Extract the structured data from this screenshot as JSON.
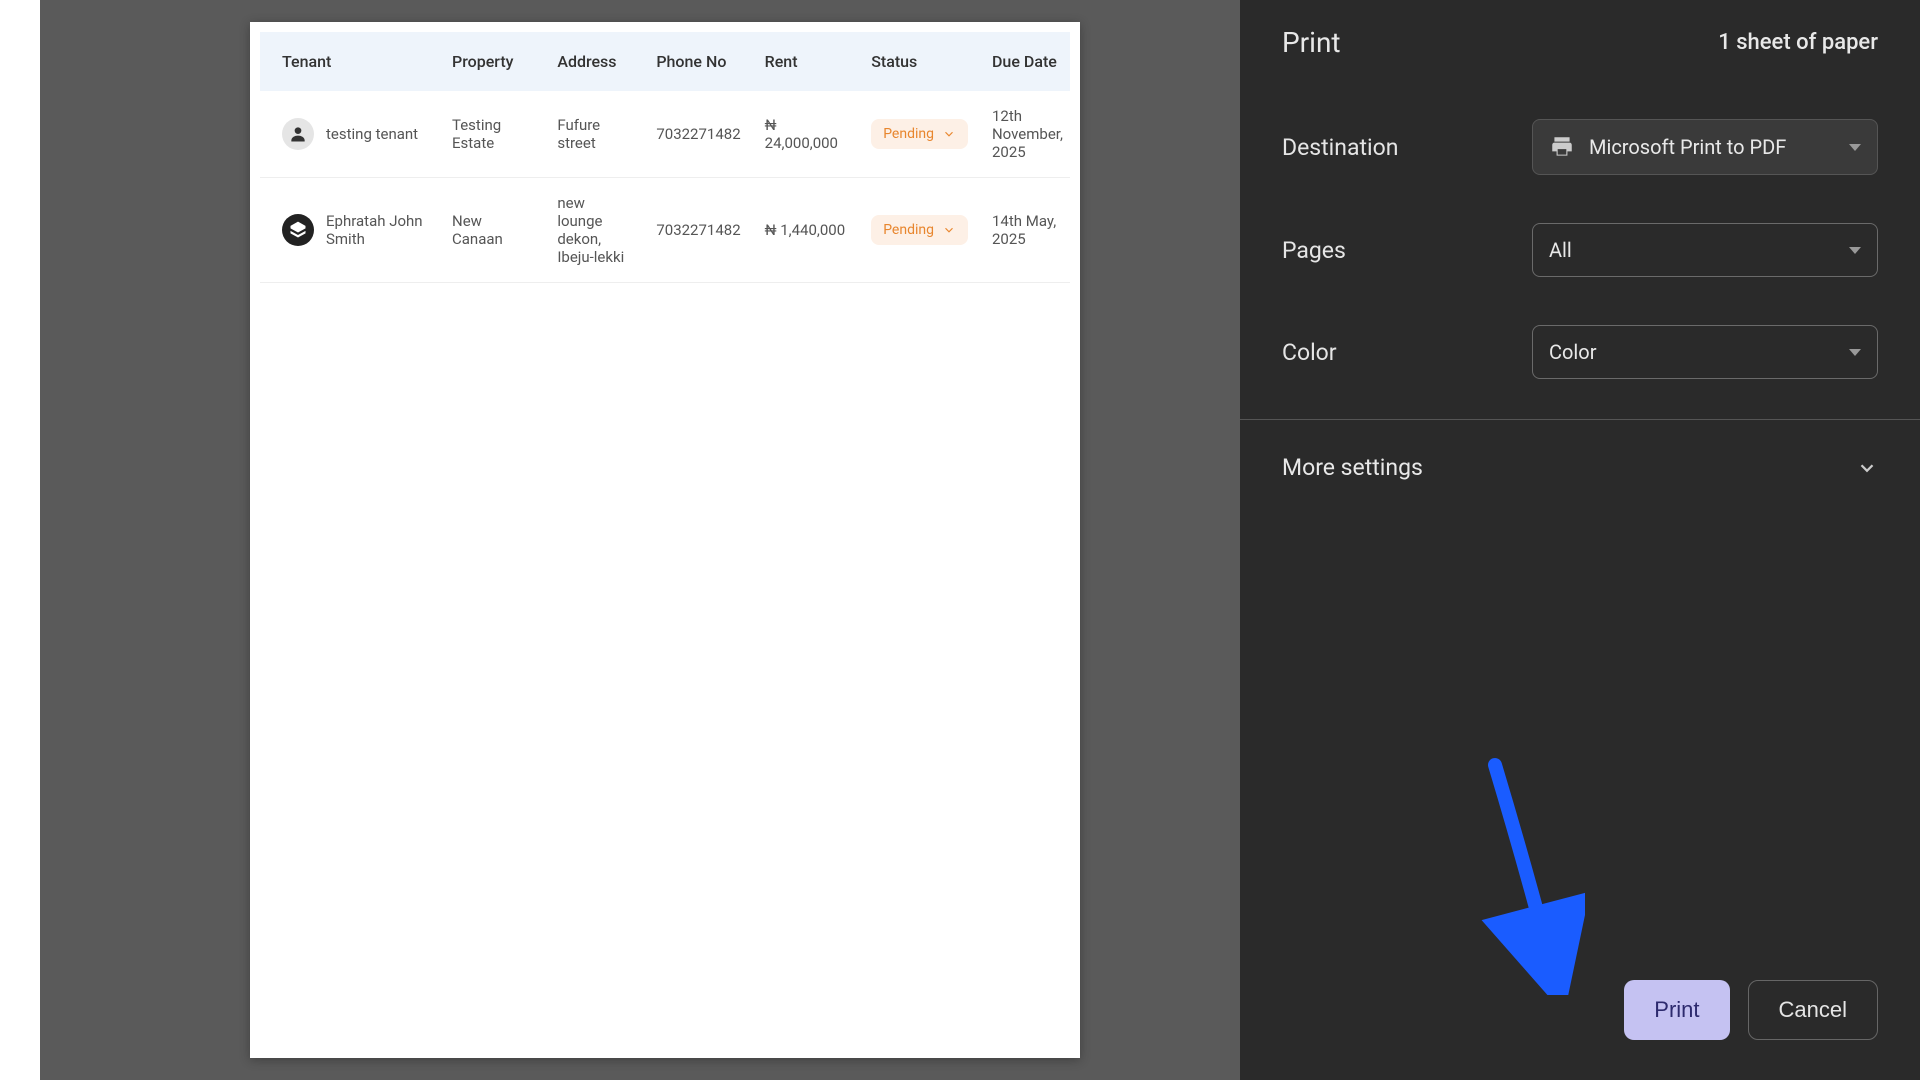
{
  "print_panel": {
    "title": "Print",
    "sheet_count": "1 sheet of paper",
    "destination_label": "Destination",
    "destination_value": "Microsoft Print to PDF",
    "pages_label": "Pages",
    "pages_value": "All",
    "color_label": "Color",
    "color_value": "Color",
    "more_settings_label": "More settings",
    "print_button": "Print",
    "cancel_button": "Cancel"
  },
  "preview": {
    "headers": {
      "tenant": "Tenant",
      "property": "Property",
      "address": "Address",
      "phone": "Phone No",
      "rent": "Rent",
      "status": "Status",
      "due": "Due Date"
    },
    "rows": [
      {
        "tenant": "testing tenant",
        "property": "Testing Estate",
        "address": "Fufure street",
        "phone": "7032271482",
        "rent": "₦ 24,000,000",
        "status": "Pending",
        "due": "12th November, 2025",
        "avatar": "person"
      },
      {
        "tenant": "Ephratah John Smith",
        "property": "New Canaan",
        "address": "new lounge dekon, Ibeju-lekki",
        "phone": "7032271482",
        "rent": "₦ 1,440,000",
        "status": "Pending",
        "due": "14th May, 2025",
        "avatar": "logo"
      }
    ]
  },
  "colors": {
    "accent": "#1a5cff",
    "status_badge_bg": "#fdf0e6",
    "status_badge_text": "#e8862e",
    "panel_bg": "#2a2a2a"
  }
}
